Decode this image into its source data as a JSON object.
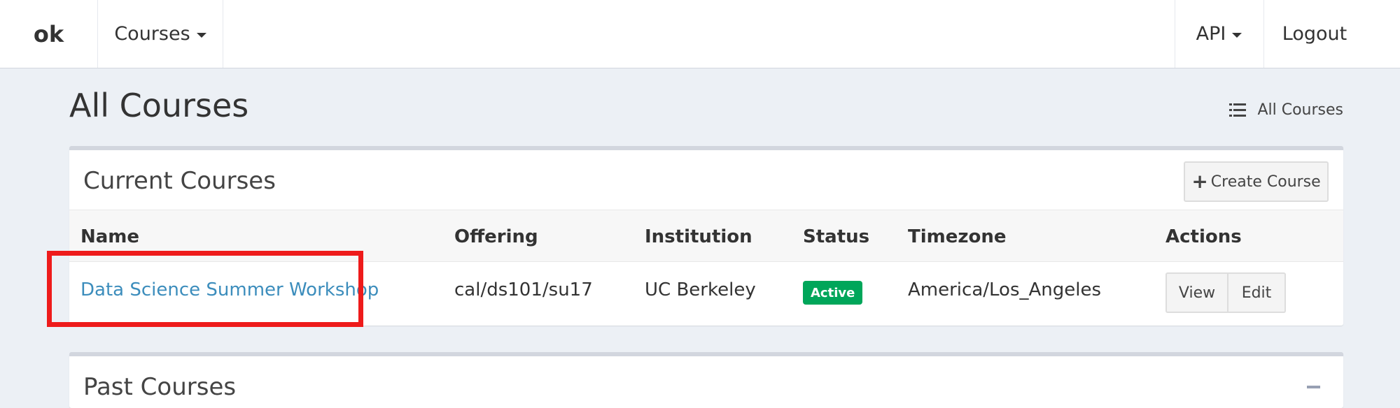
{
  "navbar": {
    "brand": "ok",
    "courses_menu": "Courses",
    "api_menu": "API",
    "logout": "Logout"
  },
  "page": {
    "title": "All Courses",
    "breadcrumb": "All Courses"
  },
  "current_courses": {
    "title": "Current Courses",
    "create_button": "Create Course",
    "columns": [
      "Name",
      "Offering",
      "Institution",
      "Status",
      "Timezone",
      "Actions"
    ],
    "rows": [
      {
        "name": "Data Science Summer Workshop",
        "offering": "cal/ds101/su17",
        "institution": "UC Berkeley",
        "status": "Active",
        "timezone": "America/Los_Angeles",
        "actions": [
          "View",
          "Edit"
        ]
      }
    ]
  },
  "past_courses": {
    "title": "Past Courses"
  },
  "colors": {
    "link": "#3c8dbc",
    "status_active": "#00a65a",
    "highlight": "#ee1b1b",
    "background": "#ecf0f5"
  },
  "icons": {
    "breadcrumb": "list-icon",
    "create": "plus-icon",
    "collapse": "minus-icon",
    "dropdown": "caret-down-icon"
  }
}
